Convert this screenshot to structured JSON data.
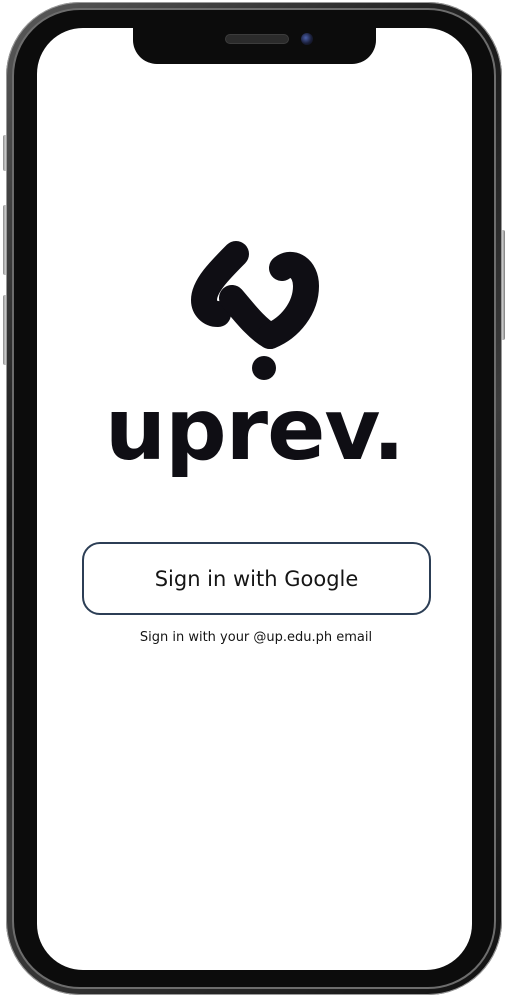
{
  "app": {
    "brand_name": "uprev.",
    "logo_icon": "uprev-s-logo-icon"
  },
  "auth": {
    "google_button_label": "Sign in with Google",
    "hint_text": "Sign in with your @up.edu.ph email"
  },
  "colors": {
    "brand_text": "#0f0e14",
    "button_border": "#2c3e55",
    "background": "#ffffff"
  }
}
